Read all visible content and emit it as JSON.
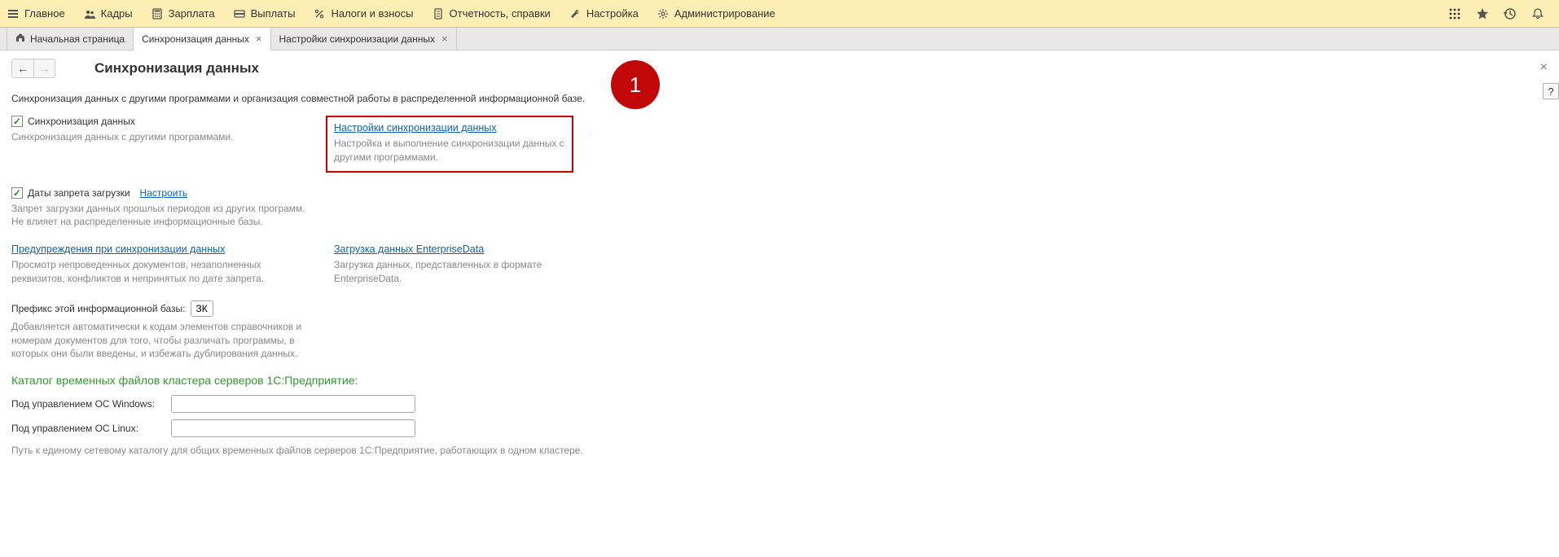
{
  "toolbar": {
    "items": [
      {
        "label": "Главное"
      },
      {
        "label": "Кадры"
      },
      {
        "label": "Зарплата"
      },
      {
        "label": "Выплаты"
      },
      {
        "label": "Налоги и взносы"
      },
      {
        "label": "Отчетность, справки"
      },
      {
        "label": "Настройка"
      },
      {
        "label": "Администрирование"
      }
    ]
  },
  "tabs": {
    "home": "Начальная страница",
    "t1": "Синхронизация данных",
    "t2": "Настройки синхронизации данных"
  },
  "page": {
    "title": "Синхронизация данных",
    "description": "Синхронизация данных с другими программами и организация совместной работы в распределенной информационной базе.",
    "sync_checkbox": "Синхронизация данных",
    "sync_desc": "Синхронизация данных с другими программами.",
    "sync_settings_link": "Настройки синхронизации данных",
    "sync_settings_desc": "Настройка и выполнение синхронизации данных с другими программами.",
    "blockdates_checkbox": "Даты запрета загрузки",
    "blockdates_configure": "Настроить",
    "blockdates_desc": "Запрет загрузки данных прошлых периодов из других программ.\nНе влияет на распределенные информационные базы.",
    "warnings_link": "Предупреждения при синхронизации данных",
    "warnings_desc": "Просмотр непроведенных документов, незаполненных реквизитов, конфликтов и непринятых по дате запрета.",
    "ed_load_link": "Загрузка данных EnterpriseData",
    "ed_load_desc": "Загрузка данных, представленных в формате EnterpriseData.",
    "prefix_label": "Префикс этой информационной базы:",
    "prefix_value": "ЗК",
    "prefix_desc": "Добавляется автоматически к кодам элементов справочников и номерам документов для того, чтобы различать программы, в которых они были введены, и избежать дублирования данных.",
    "temp_section": "Каталог временных файлов кластера серверов 1С:Предприятие:",
    "os_windows_label": "Под управлением ОС Windows:",
    "os_linux_label": "Под управлением ОС Linux:",
    "temp_desc": "Путь к единому сетевому каталогу для общих временных файлов серверов 1С:Предприятие, работающих в одном кластере.",
    "help": "?"
  },
  "callout": {
    "number": "1"
  }
}
